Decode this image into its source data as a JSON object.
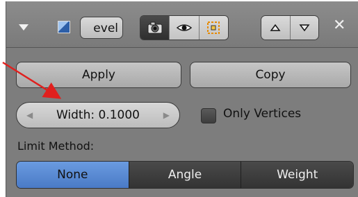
{
  "header": {
    "name_field_value": "evel",
    "icons": [
      "disclosure-triangle-icon",
      "bevel-modifier-icon",
      "render-camera-icon",
      "viewport-eye-icon",
      "editmode-icon",
      "move-up-icon",
      "move-down-icon",
      "close-icon"
    ]
  },
  "actions": {
    "apply_label": "Apply",
    "copy_label": "Copy"
  },
  "width_field": {
    "text": "Width: 0.1000"
  },
  "only_vertices": {
    "label": "Only Vertices",
    "checked": false
  },
  "limit_method": {
    "label": "Limit Method:",
    "options": [
      "None",
      "Angle",
      "Weight"
    ],
    "selected": "None"
  },
  "colors": {
    "panel_bg": "#7d7d7d",
    "active_tab": "#5a8ad4",
    "annotation_arrow": "#e0201e"
  }
}
